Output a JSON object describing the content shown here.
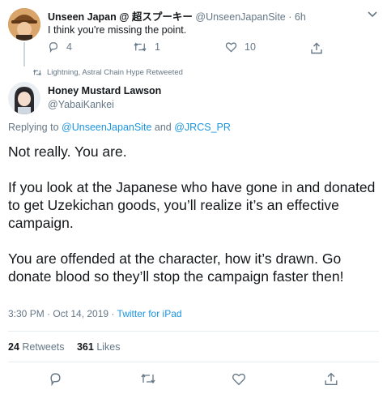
{
  "reply_tweet": {
    "display_name": "Unseen Japan @ 超スプーキー",
    "handle": "@UnseenJapanSite",
    "time": "6h",
    "text": "I think you're missing the point.",
    "reply_count": "4",
    "retweet_count": "1",
    "like_count": "10"
  },
  "retweeted_by": "Lightning, Astral Chain Hype Retweeted",
  "main_tweet": {
    "display_name": "Honey Mustard Lawson",
    "handle": "@YabaiKankei",
    "replying_prefix": "Replying to",
    "replying_to_1": "@UnseenJapanSite",
    "replying_and": "and",
    "replying_to_2": "@JRCS_PR",
    "paragraphs": [
      "Not really. You are.",
      "If you look at the Japanese who have gone in and donated to get Uzekichan goods, you’ll realize it’s an effective campaign.",
      "You are offended at the character, how it’s drawn. Go donate blood so they’ll stop the campaign faster then!"
    ],
    "timestamp": "3:30 PM · Oct 14, 2019",
    "separator": "·",
    "source": "Twitter for iPad",
    "retweets_count": "24",
    "retweets_label": "Retweets",
    "likes_count": "361",
    "likes_label": "Likes"
  },
  "colors": {
    "link": "#1b95e0",
    "muted": "#657786",
    "text": "#14171a",
    "divider": "#e6ecf0"
  }
}
